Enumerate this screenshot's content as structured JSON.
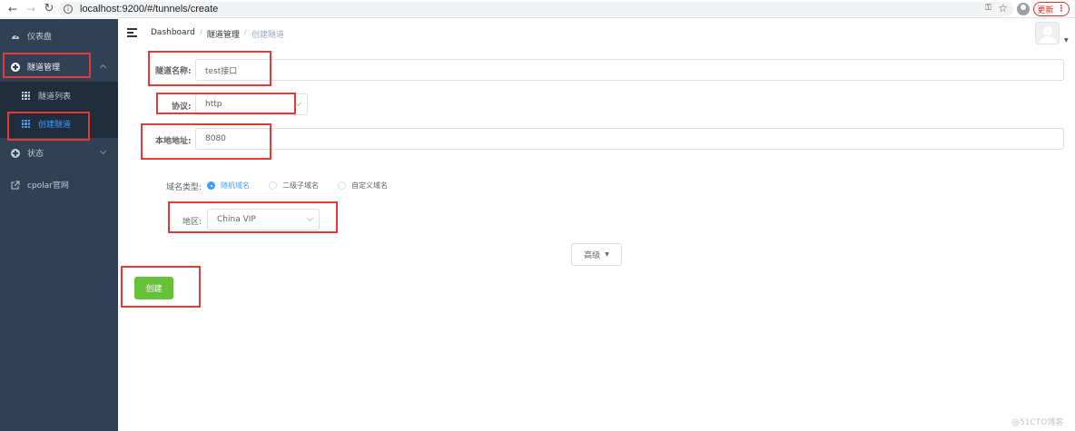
{
  "browser": {
    "url": "localhost:9200/#/tunnels/create",
    "update_label": "更新",
    "update_menu": "⋮",
    "back_icon": "arrow-left",
    "forward_icon": "arrow-right",
    "reload_icon": "reload"
  },
  "sidebar": {
    "items": [
      {
        "label": "仪表盘",
        "icon": "dashboard-icon"
      },
      {
        "label": "隧道管理",
        "icon": "plus-circle-icon"
      },
      {
        "label": "隧道列表",
        "icon": "grid-icon"
      },
      {
        "label": "创建隧道",
        "icon": "grid-icon"
      },
      {
        "label": "状态",
        "icon": "plus-circle-icon"
      },
      {
        "label": "cpolar官网",
        "icon": "external-link-icon"
      }
    ],
    "bg_color": "#304156",
    "active_color": "#409eff"
  },
  "header": {
    "breadcrumb": [
      "Dashboard",
      "隧道管理",
      "创建隧道"
    ]
  },
  "form": {
    "name_label": "隧道名称:",
    "name_value": "test接口",
    "protocol_label": "协议:",
    "protocol_value": "http",
    "local_addr_label": "本地地址:",
    "local_addr_value": "8080",
    "domain_type_label": "域名类型:",
    "domain_options": [
      "随机域名",
      "二级子域名",
      "自定义域名"
    ],
    "domain_selected": "随机域名",
    "region_label": "地区:",
    "region_value": "China VIP",
    "advanced_label": "高级",
    "create_label": "创建"
  },
  "colors": {
    "primary": "#409eff",
    "success": "#67c23a",
    "annotation": "#e53935"
  },
  "watermark": "@51CTO博客"
}
